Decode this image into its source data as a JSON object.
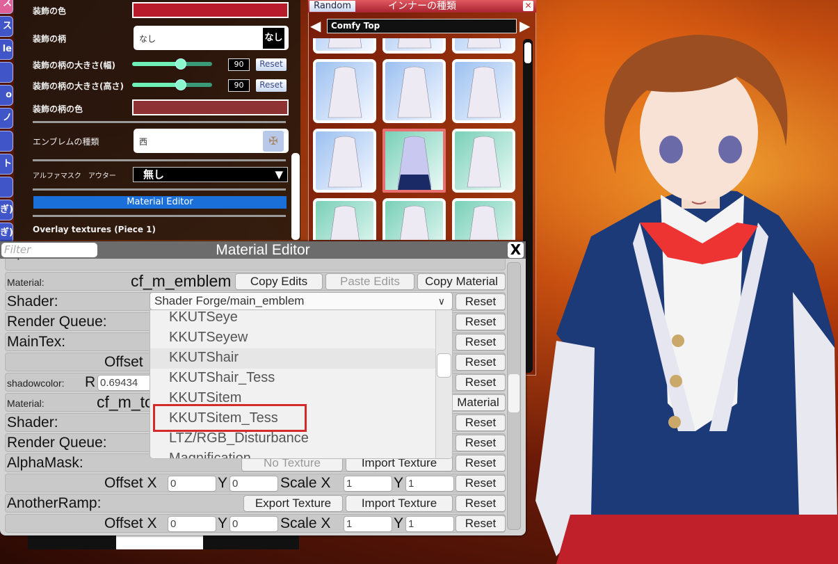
{
  "left_tabs": [
    "ス",
    "ス",
    "le",
    "",
    "o",
    "ノ",
    "",
    "ト",
    "",
    "ぎ)",
    "ぎ)"
  ],
  "left_panel": {
    "decoration_color": {
      "label": "装飾の色",
      "color": "#b81c2c"
    },
    "decoration_pattern": {
      "label": "装飾の柄",
      "value": "なし",
      "icon_text": "なし"
    },
    "pattern_width": {
      "label": "装飾の柄の大きさ(幅)",
      "value": "90",
      "percent": 62,
      "reset": "Reset"
    },
    "pattern_height": {
      "label": "装飾の柄の大きさ(高さ)",
      "value": "90",
      "percent": 62,
      "reset": "Reset"
    },
    "pattern_color": {
      "label": "装飾の柄の色",
      "color": "#8e3234"
    },
    "emblem": {
      "label": "エンブレムの種類",
      "value": "西",
      "icon": "emblem-icon"
    },
    "alpha_mask": {
      "label": "アルファマスク　アウター",
      "value": "無し"
    },
    "material_editor_button": "Material Editor",
    "overlay_label": "Overlay textures (Piece 1)"
  },
  "inner_panel": {
    "random_button": "Random",
    "title": "インナーの種類",
    "category": "Comfy Top",
    "selected_index": 7
  },
  "material_editor": {
    "title": "Material Editor",
    "filter_placeholder": "Filter",
    "close": "X",
    "top_partial": "SpecularPowerNail:",
    "material1": {
      "label": "Material:",
      "name": "cf_m_emblem",
      "copy_edits": "Copy Edits",
      "paste_edits": "Paste Edits",
      "copy_material": "Copy Material"
    },
    "shader1": {
      "label": "Shader:",
      "value": "Shader Forge/main_emblem",
      "reset": "Reset"
    },
    "render_queue1": {
      "label": "Render Queue:",
      "reset": "Reset"
    },
    "maintex": {
      "label": "MainTex:",
      "reset": "Reset"
    },
    "offset1": {
      "label": "Offset",
      "reset": "Reset"
    },
    "shadowcolor": {
      "label": "shadowcolor:",
      "r_label": "R",
      "r_value": "0.69434",
      "reset": "Reset"
    },
    "material2": {
      "label": "Material:",
      "name": "cf_m_to",
      "copy_material": "Material"
    },
    "shader2": {
      "label": "Shader:",
      "reset": "Reset"
    },
    "render_queue2": {
      "label": "Render Queue:",
      "reset": "Reset"
    },
    "alphamask": {
      "label": "AlphaMask:",
      "no_texture": "No Texture",
      "import": "Import Texture",
      "reset": "Reset"
    },
    "offset2": {
      "offset_x": "Offset X",
      "x": "0",
      "y_label": "Y",
      "y": "0",
      "scale_x": "Scale X",
      "sx": "1",
      "sy_label": "Y",
      "sy": "1",
      "reset": "Reset"
    },
    "anotherramp": {
      "label": "AnotherRamp:",
      "export": "Export Texture",
      "import": "Import Texture",
      "reset": "Reset"
    },
    "offset3": {
      "offset_x": "Offset X",
      "x": "0",
      "y_label": "Y",
      "y": "0",
      "scale_x": "Scale X",
      "sx": "1",
      "sy_label": "Y",
      "sy": "1",
      "reset": "Reset"
    },
    "shader_dropdown": {
      "items": [
        "KKUTSeye",
        "KKUTSeyew",
        "KKUTShair",
        "KKUTShair_Tess",
        "KKUTSitem",
        "KKUTSitem_Tess",
        "LTZ/RGB_Disturbance",
        "Magnification"
      ],
      "hover_index": 2,
      "highlighted_index": 5,
      "highlight_color": "#d42a2a"
    }
  }
}
